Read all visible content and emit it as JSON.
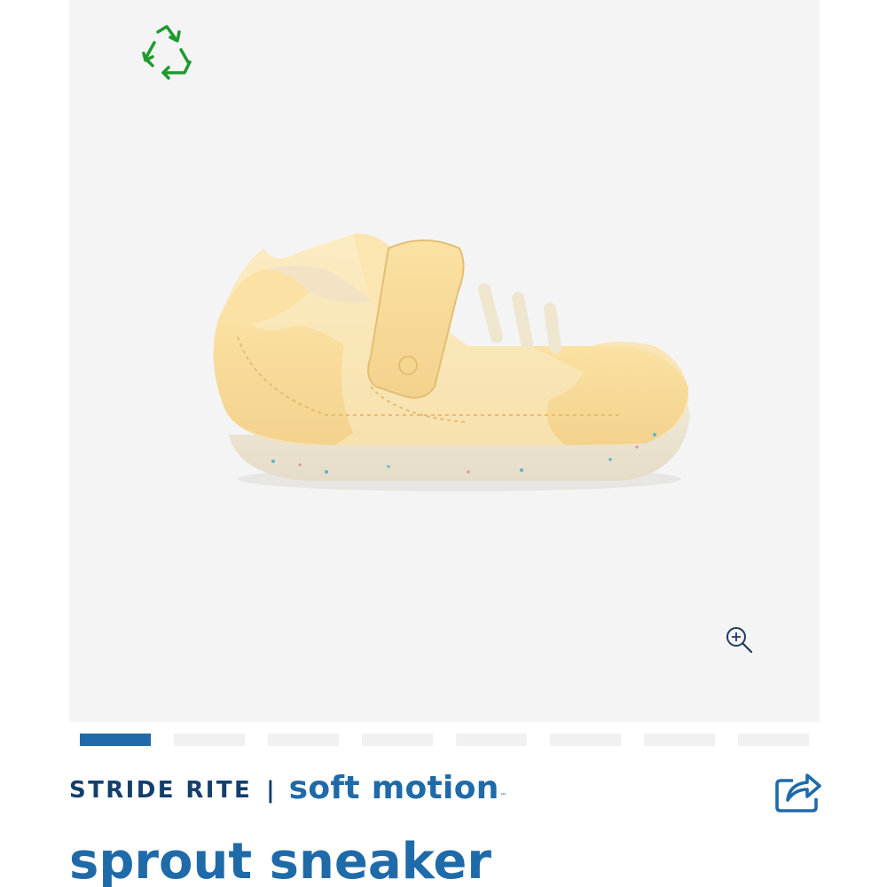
{
  "gallery": {
    "badge_icon": "recycle-icon",
    "badge_color": "#1e9a2e",
    "image_subject": "yellow toddler sneaker",
    "zoom_icon": "zoom-in-icon",
    "background": "#f4f4f4"
  },
  "pager": {
    "slides": 8,
    "active_index": 0,
    "active_color": "#1f6aa8"
  },
  "brand": {
    "name": "STRIDE RITE",
    "separator": "|",
    "sub_brand": "soft motion",
    "trademark": "™",
    "name_color": "#143e6d",
    "sub_brand_color": "#1f6aa8"
  },
  "share": {
    "icon": "share-icon"
  },
  "product": {
    "title": "sprout sneaker"
  }
}
